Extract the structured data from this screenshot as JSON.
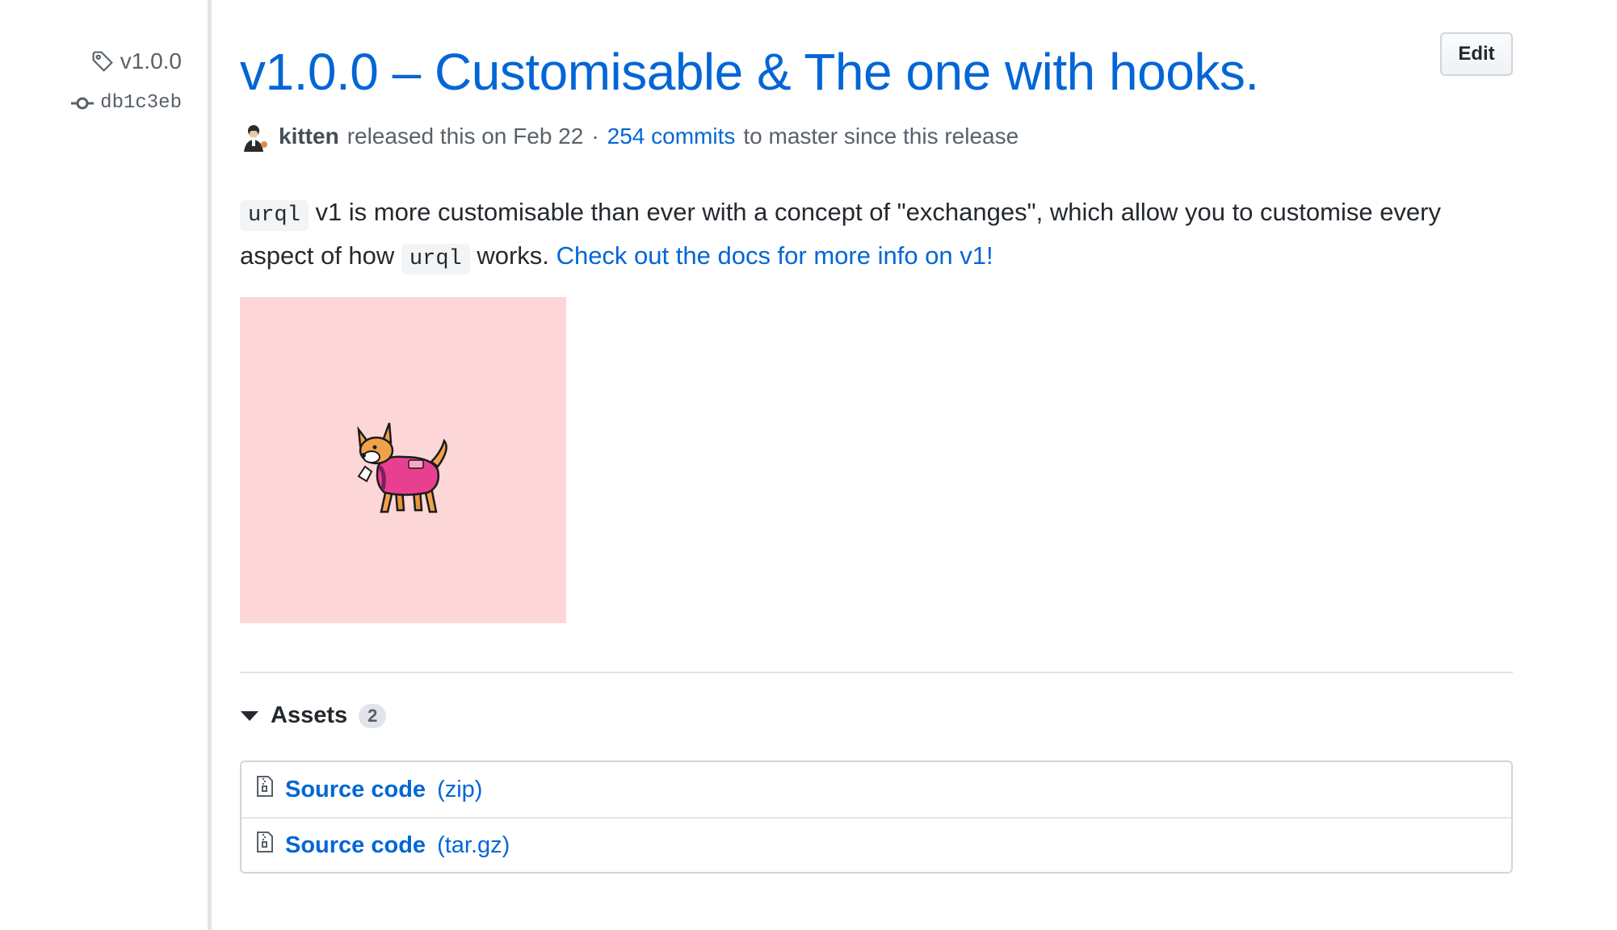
{
  "sidebar": {
    "tag": "v1.0.0",
    "commit": "db1c3eb",
    "tag_icon": "tag-icon",
    "commit_icon": "git-commit-icon"
  },
  "release": {
    "title": "v1.0.0 – Customisable & The one with hooks.",
    "edit_label": "Edit",
    "author": "kitten",
    "released_text": "released this on Feb 22",
    "separator": "·",
    "commits_link": "254 commits",
    "commits_suffix": "to master since this release"
  },
  "body": {
    "code_1": "urql",
    "text_1": "v1 is more customisable than ever with a concept of \"exchanges\", which allow you to customise every aspect of how",
    "code_2": "urql",
    "text_2": "works.",
    "docs_link": "Check out the docs for more info on v1!"
  },
  "assets": {
    "heading": "Assets",
    "count": "2",
    "items": [
      {
        "name": "Source code",
        "ext": "(zip)",
        "icon": "file-zip-icon"
      },
      {
        "name": "Source code",
        "ext": "(tar.gz)",
        "icon": "file-zip-icon"
      }
    ]
  },
  "colors": {
    "link": "#0366d6",
    "preview_bg": "#fdd6d8",
    "text": "#24292e",
    "muted": "#586069"
  }
}
